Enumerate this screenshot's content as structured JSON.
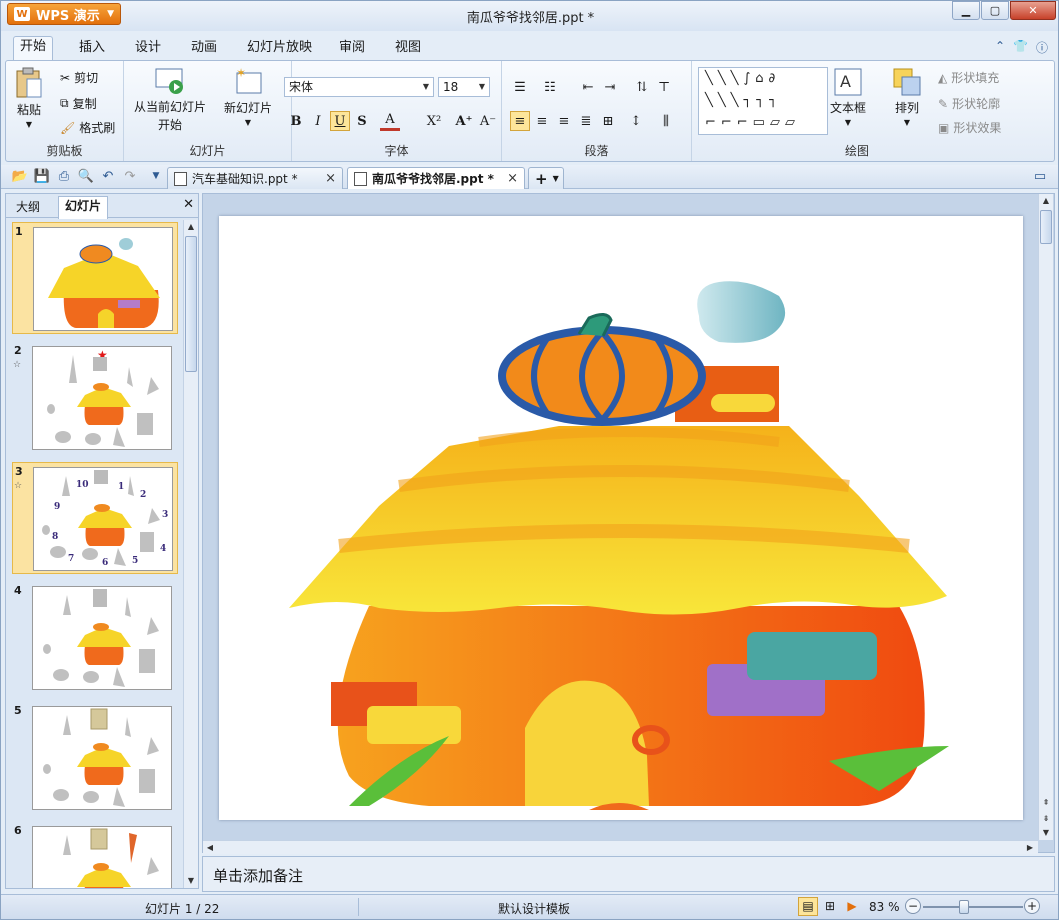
{
  "app": {
    "menu_label": "WPS 演示",
    "window_title": "南瓜爷爷找邻居.ppt *"
  },
  "ribbon_tabs": [
    "开始",
    "插入",
    "设计",
    "动画",
    "幻灯片放映",
    "审阅",
    "视图"
  ],
  "clipboard": {
    "paste": "粘贴",
    "cut": "剪切",
    "copy": "复制",
    "format_painter": "格式刷",
    "group": "剪贴板"
  },
  "slides_group": {
    "from_current": "从当前幻灯片",
    "from_current2": "开始",
    "new_slide": "新幻灯片",
    "group": "幻灯片"
  },
  "font": {
    "name": "宋体",
    "size": "18",
    "group": "字体"
  },
  "paragraph": {
    "group": "段落"
  },
  "drawing": {
    "textbox": "文本框",
    "arrange": "排列",
    "shape_fill": "形状填充",
    "shape_outline": "形状轮廓",
    "shape_effect": "形状效果",
    "group": "绘图"
  },
  "doc_tabs": [
    {
      "label": "汽车基础知识.ppt *"
    },
    {
      "label": "南瓜爷爷找邻居.ppt *"
    }
  ],
  "left_pane": {
    "tab_outline": "大纲",
    "tab_slides": "幻灯片"
  },
  "thumb_numbers": [
    "1",
    "2",
    "3",
    "4",
    "5",
    "6"
  ],
  "slide3_labels": [
    "10",
    "1",
    "2",
    "3",
    "4",
    "5",
    "6",
    "7",
    "8",
    "9"
  ],
  "notes_placeholder": "单击添加备注",
  "status": {
    "slide_info": "幻灯片 1 / 22",
    "template": "默认设计模板",
    "zoom": "83 %"
  },
  "colors": {
    "accent": "#e3700c",
    "roof": "#f6d428",
    "house": "#f06a1c",
    "pumpkin": "#f08a20"
  }
}
